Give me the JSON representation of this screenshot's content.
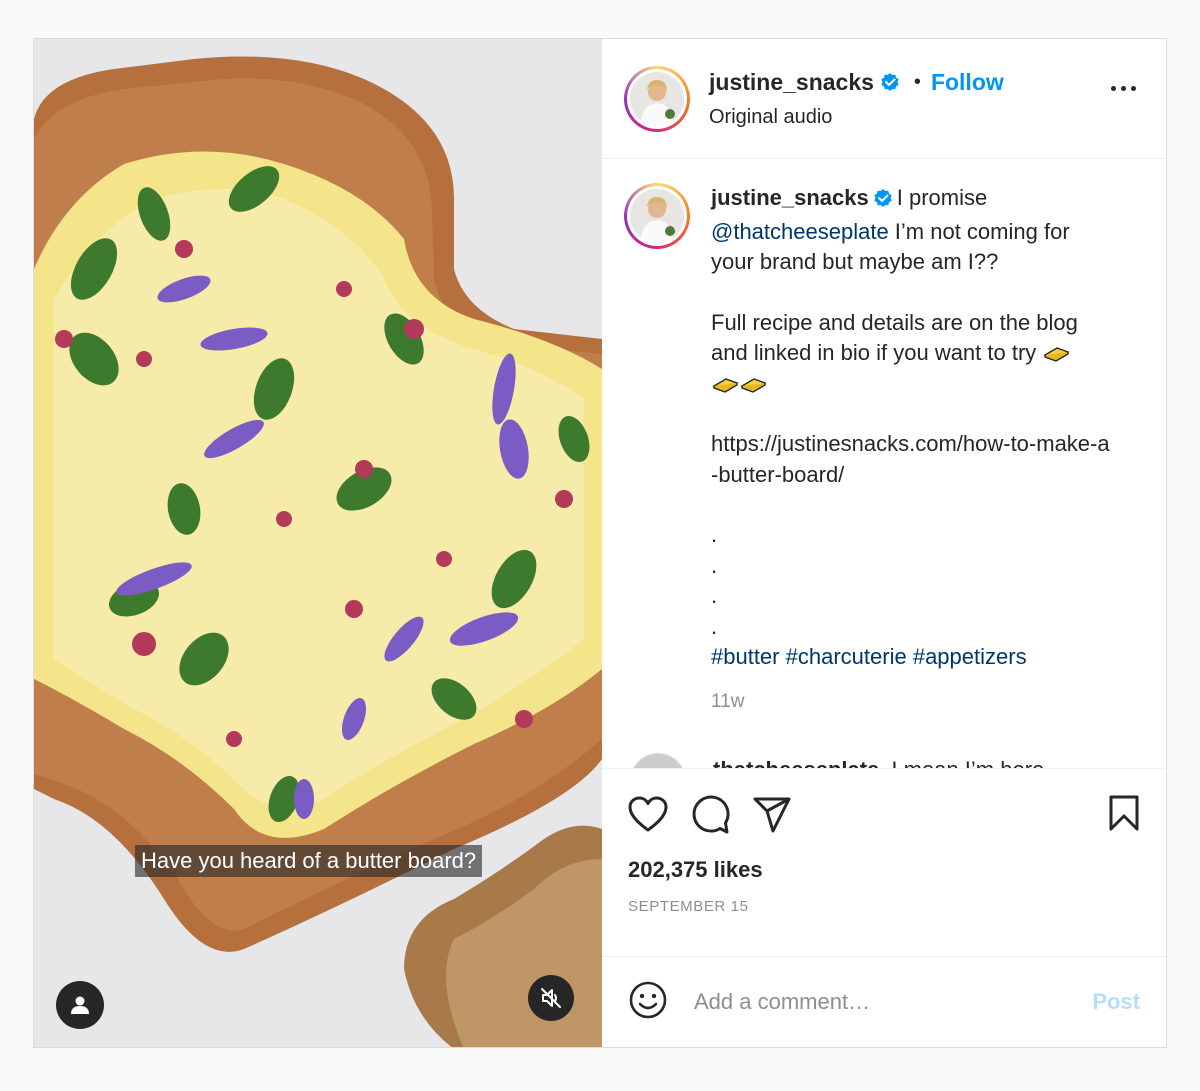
{
  "post": {
    "username": "justine_snacks",
    "separator": "•",
    "follow_label": "Follow",
    "audio": "Original audio",
    "video_subtitle": "Have you heard of a butter board?"
  },
  "caption": {
    "username": "justine_snacks",
    "line1_text": "I promise",
    "mention": "@thatcheeseplate",
    "line2_text": " I’m not coming for your brand but maybe am I??",
    "para2": "Full recipe and details are on the blog and linked in bio if you want to try",
    "link": "https://justinesnacks.com/how-to-make-a-butter-board/",
    "dot": ".",
    "hashtags": [
      "#butter",
      "#charcuterie",
      "#appetizers"
    ],
    "time": "11w"
  },
  "next_comment": {
    "username": "thatcheeseplate",
    "text": "I mean I’m here"
  },
  "engagement": {
    "likes": "202,375 likes",
    "date": "SEPTEMBER 15"
  },
  "comment_box": {
    "placeholder": "Add a comment…",
    "post_label": "Post"
  },
  "icons": {
    "verified": "verified-badge-icon",
    "more": "more-options-icon",
    "like": "heart-icon",
    "comment": "comment-bubble-icon",
    "share": "paper-plane-icon",
    "save": "bookmark-icon",
    "emoji": "emoji-smile-icon",
    "user_tag": "user-tag-icon",
    "mute": "speaker-muted-icon",
    "butter": "butter-emoji-icon"
  },
  "colors": {
    "accent": "#0095f6",
    "link_blue": "#00376b",
    "post_disabled": "#b2dffc",
    "muted_text": "#8e8e8e"
  }
}
